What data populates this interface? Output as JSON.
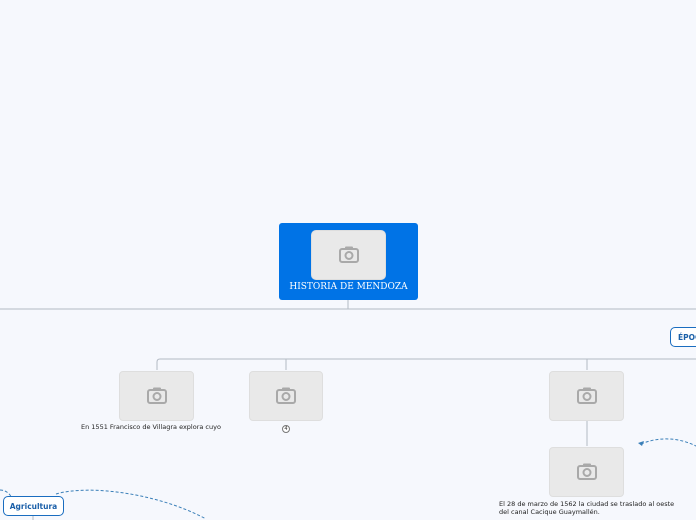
{
  "central": {
    "title": "HISTORIA DE MENDOZA",
    "color": "#0073e6"
  },
  "topics": {
    "epoca": "ÉPOC",
    "agricultura": "Agricultura"
  },
  "nodes": {
    "villagra": "En 1551 Francisco de Villagra explora cuyo",
    "badge": "4",
    "traslado": "El 28 de marzo de 1562 la ciudad se traslado al oeste del canal Cacique Guaymallén."
  },
  "icons": {
    "image_placeholder": "camera-icon"
  },
  "colors": {
    "line": "#b3bac4",
    "dashed": "#3a7fb8",
    "topic_border": "#1a6dc0"
  }
}
